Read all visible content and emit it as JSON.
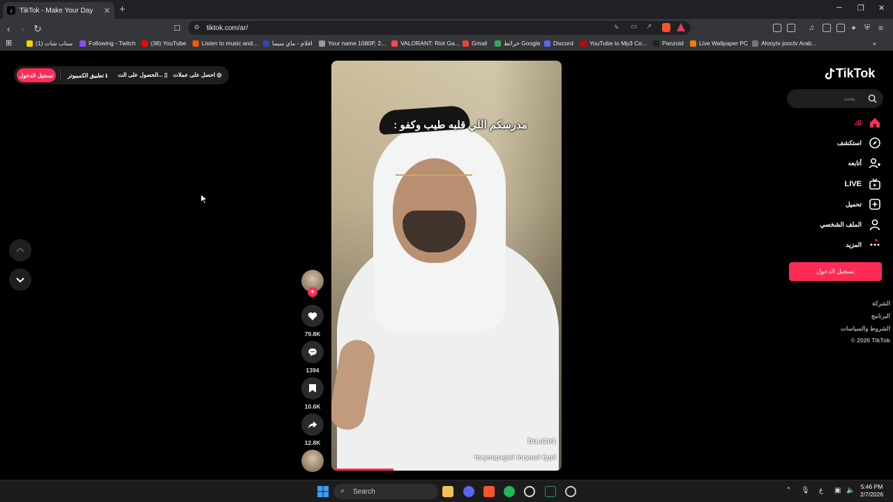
{
  "browser": {
    "tab_title": "TikTok - Make Your Day",
    "new_tab": "+",
    "url": "tiktok.com/ar/",
    "win_minimize": "─",
    "win_restore": "❐",
    "win_close": "✕"
  },
  "bookmarks": [
    {
      "label": "سناب شات (1)",
      "color": "#f7d400"
    },
    {
      "label": "Following - Twitch",
      "color": "#9146ff"
    },
    {
      "label": "(38) YouTube",
      "color": "#ff0000"
    },
    {
      "label": "Listen to music and...",
      "color": "#ff5500"
    },
    {
      "label": "افلام - ماي سيما",
      "color": "#3344aa"
    },
    {
      "label": "Your name 1080P, 2...",
      "color": "#999999"
    },
    {
      "label": "VALORANT: Riot Ga...",
      "color": "#ff4655"
    },
    {
      "label": "Gmail",
      "color": "#ea4335"
    },
    {
      "label": "خرائط Google",
      "color": "#34a853"
    },
    {
      "label": "Discord",
      "color": "#5865f2"
    },
    {
      "label": "YouTube to Mp3 Co...",
      "color": "#cc0000"
    },
    {
      "label": "Panzoid",
      "color": "#222222"
    },
    {
      "label": "Live Wallpaper PC",
      "color": "#ff7a00"
    },
    {
      "label": "Alooytv jooctv Arab...",
      "color": "#777777"
    }
  ],
  "top_actions": {
    "login": "تسجيل الدخول",
    "desktop_app": "تطبيق الكمبيوتر",
    "get_app": "الحصول على الت...",
    "get_coins": "احصل على عملات"
  },
  "video": {
    "caption": "مدرسكم اللي قلبه طيب وكفو :",
    "username": "bu.aze1",
    "hashtags": "foryoupage# foryou# fyp#",
    "progress": 0.27
  },
  "actions": {
    "likes": "79.8K",
    "comments": "1394",
    "saves": "10.6K",
    "shares": "12.8K"
  },
  "sidebar": {
    "logo": "TikTok",
    "search_placeholder": "بحث",
    "nav": [
      {
        "label": "لك",
        "icon": "home-icon"
      },
      {
        "label": "استكشف",
        "icon": "compass-icon"
      },
      {
        "label": "أتابعه",
        "icon": "following-icon"
      },
      {
        "label": "LIVE",
        "icon": "live-icon"
      },
      {
        "label": "تحميل",
        "icon": "upload-icon"
      },
      {
        "label": "الملف الشخصي",
        "icon": "profile-icon"
      },
      {
        "label": "المزيد",
        "icon": "more-icon"
      }
    ],
    "login_button": "تسجيل الدخول",
    "footer": [
      "الشركة",
      "البرنامج",
      "الشروط والسياسات",
      "© 2026 TikTok"
    ]
  },
  "taskbar": {
    "search": "Search",
    "time": "5:46 PM",
    "date": "2/7/2026",
    "lang": "ع"
  },
  "colors": {
    "accent": "#fe2c55",
    "bg": "#000000",
    "chrome": "#35363a"
  }
}
